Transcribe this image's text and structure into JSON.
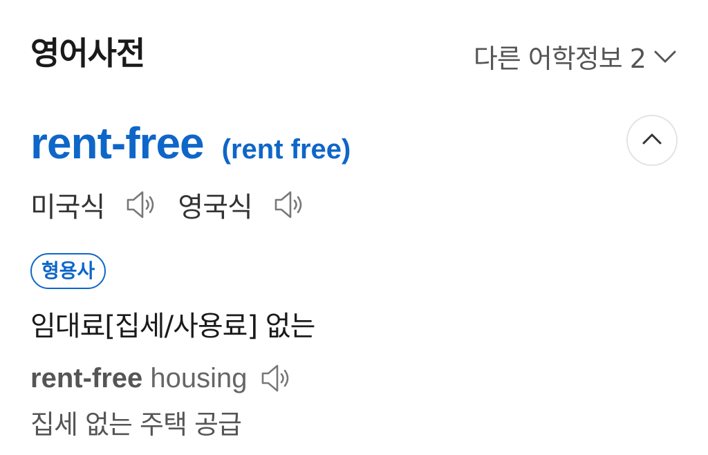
{
  "header": {
    "title": "영어사전",
    "more_info_label": "다른 어학정보 2"
  },
  "entry": {
    "headword": "rent-free",
    "variant": "(rent free)",
    "pronunciations": [
      {
        "label": "미국식"
      },
      {
        "label": "영국식"
      }
    ],
    "pos": "형용사",
    "definition": "임대료[집세/사용료] 없는",
    "example": {
      "headword_part": "rent-free",
      "rest": " housing",
      "translation": "집세 없는 주택 공급"
    }
  },
  "icons": {
    "chevron": "chevron-down-icon",
    "collapse": "chevron-up-icon",
    "speaker": "speaker-icon"
  },
  "colors": {
    "accent": "#0e66c8",
    "text": "#1a1a1a",
    "muted": "#555555"
  }
}
